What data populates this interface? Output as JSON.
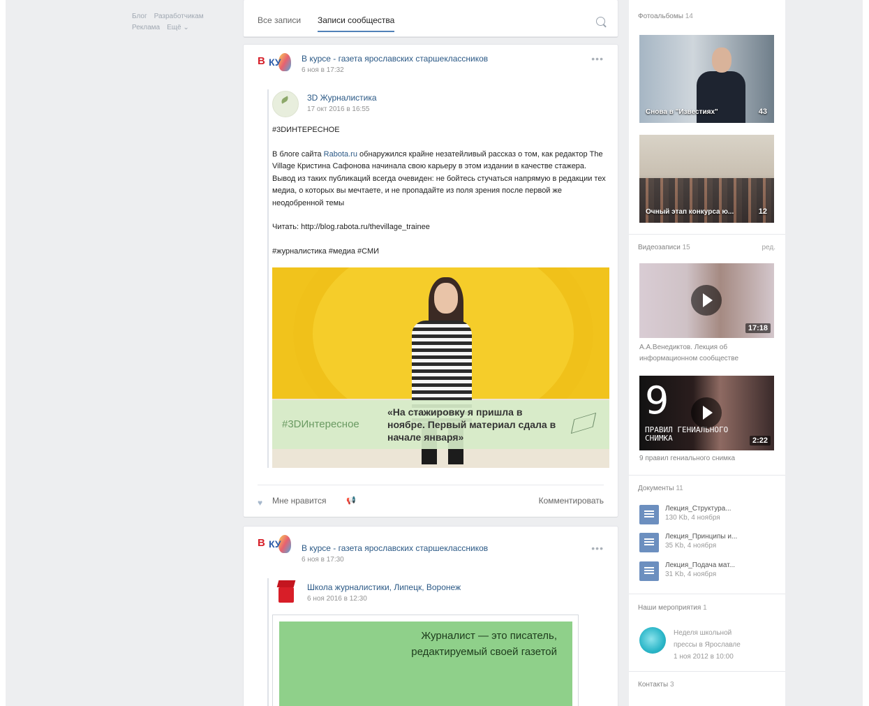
{
  "footer": {
    "blog": "Блог",
    "developers": "Разработчикам",
    "ads": "Реклама",
    "more": "Ещё ⌄"
  },
  "tabs": {
    "all": "Все записи",
    "community": "Записи сообщества"
  },
  "post1": {
    "author": "В курсе - газета ярославских старшеклассников",
    "date": "6 ноя в 17:32",
    "logo_v": "В",
    "logo_ky": "КУ",
    "repost": {
      "author": "3D Журналистика",
      "date": "17 окт 2016 в 16:55",
      "hashtag": "#3DИНТЕРЕСНОЕ",
      "p1_before": "В блоге сайта ",
      "p1_link": "Rabota.ru",
      "p1_after": " обнаружился крайне незатейливый рассказ о том, как редактор The Village Кристина Сафонова начинала свою карьеру в этом издании в качестве стажера. Вывод из таких публикаций всегда очевиден: не бойтесь стучаться напрямую в редакции тех медиа, о которых вы мечтаете, и не пропадайте из поля зрения после первой же неодобренной темы",
      "read": "Читать: http://blog.rabota.ru/thevillage_trainee",
      "tags": "#журналистика #медиа #СМИ",
      "image_tag": "#3DИнтересное",
      "image_quote": "«На стажировку я пришла в ноябре. Первый материал сдала в начале января»"
    },
    "like": "Мне нравится",
    "comment": "Комментировать"
  },
  "post2": {
    "author": "В курсе - газета ярославских старшеклассников",
    "date": "6 ноя в 17:30",
    "repost": {
      "author": "Школа журналистики, Липецк, Воронеж",
      "date": "6 ноя 2016 в 12:30",
      "quote": "Журналист — это писатель, редактируемый своей газетой"
    }
  },
  "sidebar": {
    "photos": {
      "title": "Фотоальбомы",
      "count": "14",
      "albums": [
        {
          "label": "Снова в \"Известиях\"",
          "count": "43"
        },
        {
          "label": "Очный этап конкурса ю...",
          "count": "12"
        }
      ]
    },
    "videos": {
      "title": "Видеозаписи",
      "count": "15",
      "edit": "ред.",
      "items": [
        {
          "duration": "17:18",
          "caption": "А.А.Венедиктов. Лекция об информационном сообществе"
        },
        {
          "duration": "2:22",
          "caption": "9 правил гениального снимка",
          "big": "9",
          "overlay": "ПРАВИЛ ГЕНИАЛЬНОГО СНИМКА"
        }
      ]
    },
    "docs": {
      "title": "Документы",
      "count": "11",
      "items": [
        {
          "name": "Лекция_Структура...",
          "meta": "130 Kb, 4 ноября"
        },
        {
          "name": "Лекция_Принципы и...",
          "meta": "35 Kb, 4 ноября"
        },
        {
          "name": "Лекция_Подача мат...",
          "meta": "31 Kb, 4 ноября"
        }
      ]
    },
    "events": {
      "title": "Наши мероприятия",
      "count": "1",
      "item": {
        "line1": "Неделя школьной",
        "line2": "прессы в Ярославле",
        "line3": "1 ноя 2012 в 10:00"
      }
    },
    "contacts": {
      "title": "Контакты",
      "count": "3"
    }
  }
}
